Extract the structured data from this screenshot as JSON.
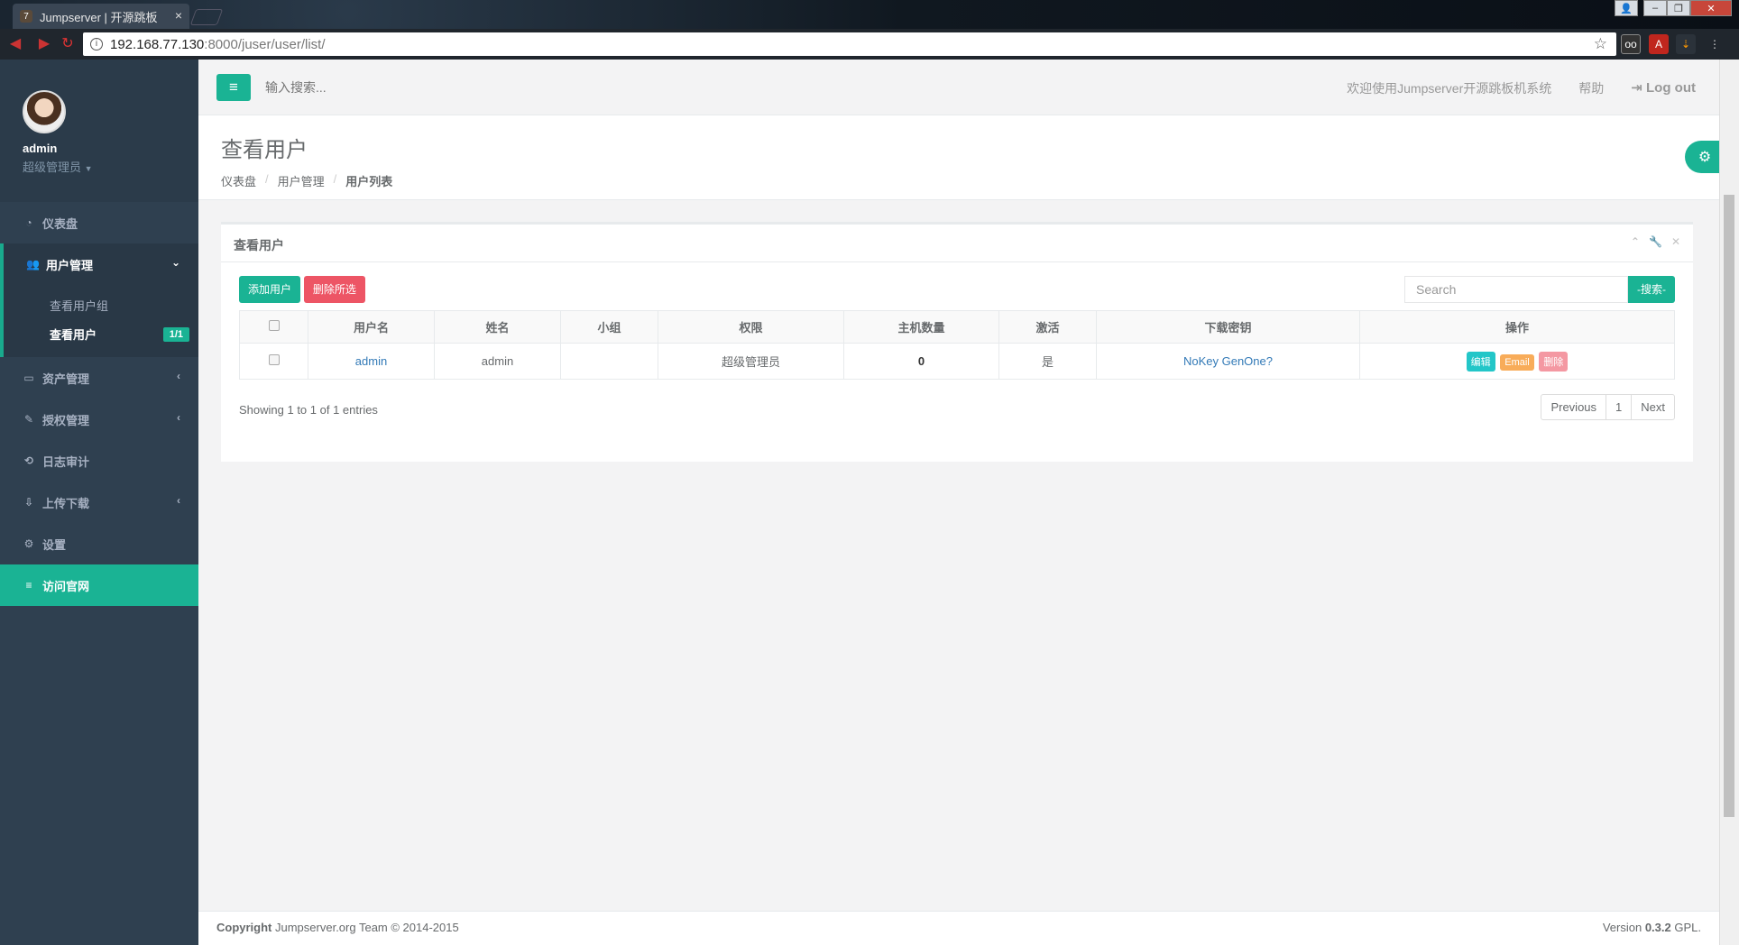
{
  "browser": {
    "tab_title": "Jumpserver | 开源跳板",
    "url_host": "192.168.77.130",
    "url_rest": ":8000/juser/user/list/"
  },
  "user": {
    "name": "admin",
    "role": "超级管理员"
  },
  "sidebar": {
    "items": [
      {
        "label": "仪表盘"
      },
      {
        "label": "用户管理"
      },
      {
        "label": "资产管理"
      },
      {
        "label": "授权管理"
      },
      {
        "label": "日志审计"
      },
      {
        "label": "上传下载"
      },
      {
        "label": "设置"
      },
      {
        "label": "访问官网"
      }
    ],
    "submenu": [
      {
        "label": "查看用户组"
      },
      {
        "label": "查看用户",
        "badge": "1/1"
      }
    ]
  },
  "topnav": {
    "search_placeholder": "输入搜索...",
    "welcome": "欢迎使用Jumpserver开源跳板机系统",
    "help": "帮助",
    "logout": "Log out"
  },
  "page": {
    "title": "查看用户",
    "breadcrumb": [
      "仪表盘",
      "用户管理",
      "用户列表"
    ]
  },
  "panel": {
    "title": "查看用户",
    "add_button": "添加用户",
    "delete_button": "删除所选",
    "search_placeholder": "Search",
    "search_button": "-搜索-",
    "columns": [
      "用户名",
      "姓名",
      "小组",
      "权限",
      "主机数量",
      "激活",
      "下载密钥",
      "操作"
    ],
    "rows": [
      {
        "username": "admin",
        "name": "admin",
        "group": "",
        "role": "超级管理员",
        "hosts": "0",
        "active": "是",
        "key": "NoKey GenOne?",
        "actions": [
          "编辑",
          "Email",
          "删除"
        ]
      }
    ],
    "info": "Showing 1 to 1 of 1 entries",
    "pager": [
      "Previous",
      "1",
      "Next"
    ]
  },
  "footer": {
    "copyright_label": "Copyright",
    "copyright_text": " Jumpserver.org Team © 2014-2015",
    "version_prefix": "Version ",
    "version": "0.3.2",
    "version_suffix": " GPL."
  }
}
